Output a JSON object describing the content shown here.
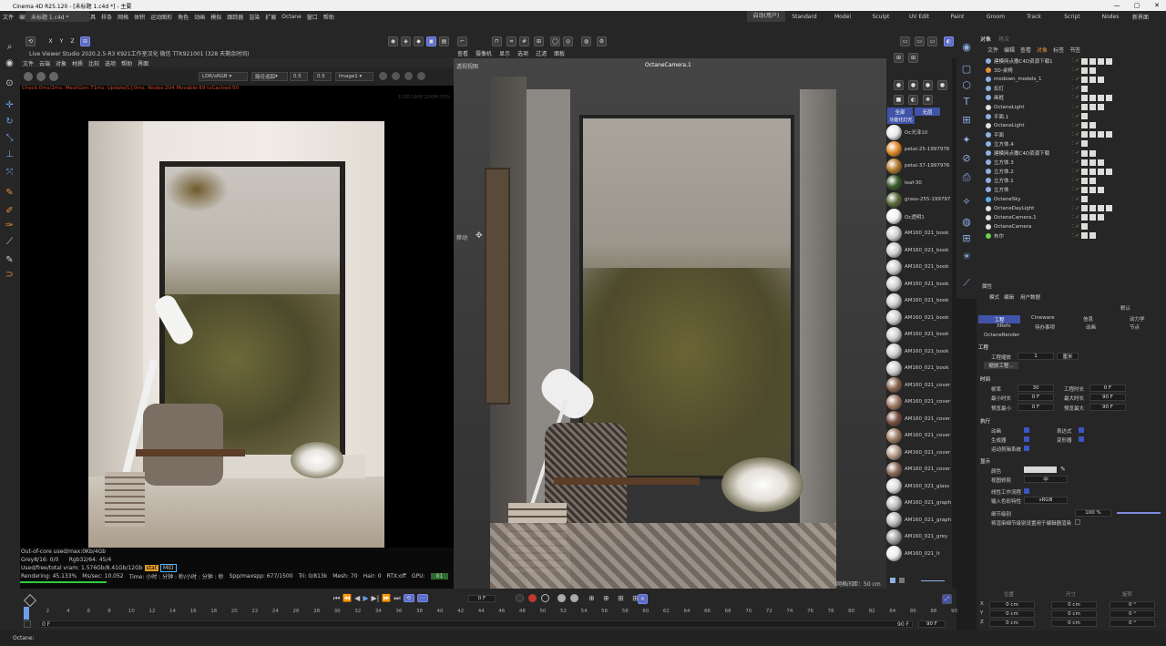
{
  "window": {
    "title": "Cinema 4D R25.120 - [未标题 1.c4d *] - 主要"
  },
  "menubar": {
    "items": [
      "文件",
      "编辑",
      "创建",
      "模式",
      "选择",
      "工具",
      "样条",
      "网格",
      "体积",
      "运动图形",
      "角色",
      "动画",
      "模拟",
      "跟踪器",
      "渲染",
      "扩展",
      "Octane",
      "窗口",
      "帮助"
    ],
    "layouts": [
      "启动(用户)",
      "Standard",
      "Model",
      "Sculpt",
      "UV Edit",
      "Paint",
      "Groom",
      "Track",
      "Script",
      "Nodes"
    ],
    "active_layout": "启动(用户)",
    "new_layout": "新界面"
  },
  "doc_tab": "未标题 1.c4d *",
  "axes": [
    "X",
    "Y",
    "Z"
  ],
  "live_viewer": {
    "title": "Live Viewer Studio 2020.2.5-R3  K921工作室汉化  微信 TTK921001 (328 天剩余时间)",
    "menu": [
      "文件",
      "云端",
      "对象",
      "材质",
      "比较",
      "选项",
      "帮助",
      "界面"
    ],
    "color_space": "LDR/sRGB",
    "tonemap": "路径追踪",
    "value1": "0.5",
    "value2": "0.5",
    "image": "Image1",
    "status_line": "Check:0ms/2ms. MeshGen:71ms. Update[L]:0ms. Nodes:204 Movable:69 txCached:50",
    "zoom": "1100:1900 ZOOM:55%",
    "info": {
      "out_of_core": "Out-of-core used/max:0Kb/4Gb",
      "grey": "Grey8/16: 0/0",
      "rgb": "Rgb32/64: 45/4",
      "vram": "Used/free/total vram: 1.576Gb/8.41Gb/12Gb",
      "vram_tags": [
        "stat",
        "MID"
      ],
      "rendering": "Rendering: 45.133%",
      "ms_sec": "Ms/sec: 10.052",
      "time": "Time: 小时 : 分钟 : 秒/小时 : 分钟 : 秒",
      "spp": "Spp/maxspp: 677/1500",
      "tri": "Tri: 0/813k",
      "mesh": "Mesh: 70",
      "hair": "Hair: 0",
      "rtx": "RTX:off",
      "gpu_label": "GPU:",
      "gpu_value": "81",
      "progress": 0.45
    }
  },
  "viewport": {
    "menu": [
      "查看",
      "摄像机",
      "显示",
      "选项",
      "过滤",
      "面板"
    ],
    "name": "透视视图",
    "camera": "OctaneCamera.1",
    "move_label": "移动",
    "grid_info": "网格间距：50 cm"
  },
  "materials": {
    "tabs": [
      "全部",
      "无层"
    ],
    "sub": "功能化灯光",
    "items": [
      {
        "name": "Oc光泽10",
        "color": "#e8e8e8"
      },
      {
        "name": "petal-25-1997976",
        "color": "#e08a2a"
      },
      {
        "name": "petal-37-1997976",
        "color": "#b27a2c"
      },
      {
        "name": "leaf-30",
        "color": "#3a5a2a"
      },
      {
        "name": "grass-255-199797",
        "color": "#5a6a3a"
      },
      {
        "name": "Oc透明1",
        "color": "#f0f0f0"
      },
      {
        "name": "AM160_021_book",
        "color": "#cfcfcf"
      },
      {
        "name": "AM160_021_book",
        "color": "#cfcfcf"
      },
      {
        "name": "AM160_021_book",
        "color": "#cfcfcf"
      },
      {
        "name": "AM160_021_book",
        "color": "#cfcfcf"
      },
      {
        "name": "AM160_021_book",
        "color": "#cfcfcf"
      },
      {
        "name": "AM160_021_book",
        "color": "#cfcfcf"
      },
      {
        "name": "AM160_021_book",
        "color": "#cfcfcf"
      },
      {
        "name": "AM160_021_book",
        "color": "#cfcfcf"
      },
      {
        "name": "AM160_021_book",
        "color": "#cfcfcf"
      },
      {
        "name": "AM160_021_cover",
        "color": "#8a6450"
      },
      {
        "name": "AM160_021_cover",
        "color": "#a07a66"
      },
      {
        "name": "AM160_021_cover",
        "color": "#7a5040"
      },
      {
        "name": "AM160_021_cover",
        "color": "#9a7a60"
      },
      {
        "name": "AM160_021_cover",
        "color": "#b59a88"
      },
      {
        "name": "AM160_021_cover",
        "color": "#8a6a58"
      },
      {
        "name": "AM160_021_glass",
        "color": "#dadada"
      },
      {
        "name": "AM160_021_graph",
        "color": "#bdbdbd"
      },
      {
        "name": "AM160_021_graph",
        "color": "#bdbdbd"
      },
      {
        "name": "AM160_021_grey",
        "color": "#a0a0a0"
      },
      {
        "name": "AM160_021_lt",
        "color": "#ececec"
      }
    ]
  },
  "objects": {
    "tabs": [
      "对象",
      "场次"
    ],
    "menu": [
      "文件",
      "编辑",
      "查看",
      "对象",
      "标签",
      "书签"
    ],
    "items": [
      "建模网点撒C4D资源下载1",
      "3D-桌椅",
      "modown_models_1",
      "扣灯",
      "画框",
      "OctaneLight",
      "平面.1",
      "OctaneLight",
      "平面",
      "立方体.4",
      "建模网点撒C4D资源下载",
      "立方体.3",
      "立方体.2",
      "立方体.1",
      "立方体",
      "OctaneSky",
      "OctaneDayLight",
      "OctaneCamera.1",
      "OctaneCamera",
      "布尔"
    ]
  },
  "attributes": {
    "title": "属性",
    "menu": [
      "模式",
      "编辑",
      "用户数据"
    ],
    "preset": "默认",
    "tabs": [
      "工程",
      "Cineware",
      "信息",
      "动力学",
      "XRefs",
      "待办事项",
      "动画",
      "节点"
    ],
    "octane_render": "OctaneRender",
    "section_project": "工程",
    "scale_label": "工程缩放",
    "scale_value": "1",
    "scale_unit": "厘米",
    "scale_btn": "缩放工程...",
    "time_section": "时间",
    "fps_label": "帧率",
    "fps_value": "30",
    "length_label": "工程时长",
    "length_value": "0 F",
    "min_label": "最小时长",
    "min_value": "0 F",
    "max_label": "最大时长",
    "max_value": "90 F",
    "prevmin_label": "预览最小",
    "prevmin_value": "0 F",
    "prevmax_label": "预览最大",
    "prevmax_value": "90 F",
    "exec_section": "执行",
    "exec": [
      "动画",
      "生成器",
      "运动剪辑系统"
    ],
    "exec2": [
      "表达式",
      "变形器"
    ],
    "display_section": "显示",
    "color_label": "颜色",
    "view_clip_label": "视图修剪",
    "view_clip_value": "中",
    "linear_label": "线性工作流程",
    "input_color_label": "输入色彩特性",
    "input_color_value": "sRGB",
    "detail_label": "细节级别",
    "detail_value": "100 %",
    "render_lod_label": "将渲染细节级别设置用于编辑器渲染"
  },
  "timeline": {
    "current": "0 F",
    "ruler": [
      "0",
      "2",
      "4",
      "6",
      "8",
      "10",
      "12",
      "14",
      "16",
      "18",
      "20",
      "22",
      "24",
      "26",
      "28",
      "30",
      "32",
      "34",
      "36",
      "38",
      "40",
      "42",
      "44",
      "46",
      "48",
      "50",
      "52",
      "54",
      "56",
      "58",
      "60",
      "62",
      "64",
      "66",
      "68",
      "70",
      "72",
      "74",
      "76",
      "78",
      "80",
      "82",
      "84",
      "86",
      "88",
      "90"
    ],
    "start": "0 F",
    "range_start": "0 F",
    "range_end": "90 F",
    "end": "90 F"
  },
  "coords": {
    "headers": [
      "位置",
      "尺寸",
      "旋转"
    ],
    "rows": [
      {
        "axis": "X",
        "pos": "0 cm",
        "size": "0 cm",
        "rot": "0 °"
      },
      {
        "axis": "Y",
        "pos": "0 cm",
        "size": "0 cm",
        "rot": "0 °"
      },
      {
        "axis": "Z",
        "pos": "0 cm",
        "size": "0 cm",
        "rot": "0 °"
      }
    ]
  },
  "status": "Octane:"
}
